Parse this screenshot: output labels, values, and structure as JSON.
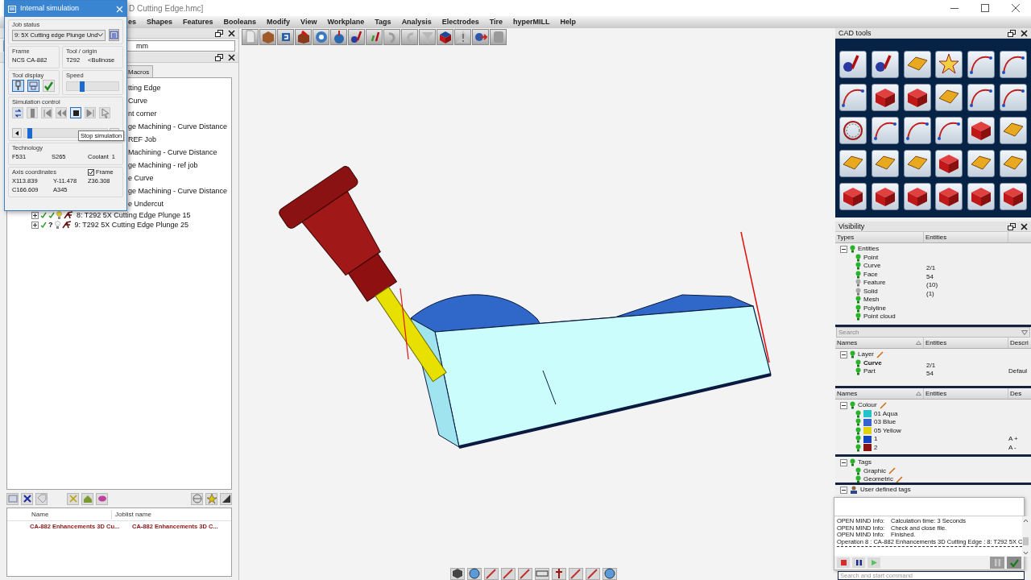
{
  "window": {
    "title": "D Cutting Edge.hmc]"
  },
  "menu": [
    "es",
    "Shapes",
    "Features",
    "Booleans",
    "Modify",
    "View",
    "Workplane",
    "Tags",
    "Analysis",
    "Electrodes",
    "Tire",
    "hyperMILL",
    "Help"
  ],
  "browser": {
    "field_value": "mm",
    "tabs": [
      {
        "label": "Macros",
        "selected": false
      }
    ],
    "tree": [
      {
        "text": "tting Edge"
      },
      {
        "text": "Curve"
      },
      {
        "text": "nt corner"
      },
      {
        "text": "ge Machining - Curve Distance"
      },
      {
        "text": "REF Job"
      },
      {
        "text": "Machining - Curve Distance"
      },
      {
        "text": "ge Machining - ref job"
      },
      {
        "text": "e Curve"
      },
      {
        "text": "ge Machining - Curve Distance"
      },
      {
        "text": "e Undercut"
      }
    ],
    "jobs": [
      {
        "text": "8: T292 5X Cutting Edge Plunge 15",
        "expanded": false,
        "visible": true
      },
      {
        "text": "9: T292 5X Cutting Edge Plunge 25",
        "expanded": false,
        "visible": false,
        "mark": "?"
      }
    ],
    "joblist": {
      "columns": [
        "Name",
        "Joblist name"
      ],
      "rows": [
        [
          "CA-882 Enhancements 3D Cu...",
          "CA-882 Enhancements 3D C..."
        ]
      ]
    }
  },
  "simulation": {
    "title": "Internal simulation",
    "job_status_label": "Job status",
    "job": "9: 5X Cutting edge Plunge Und",
    "frame_label": "Frame",
    "frame": "NCS CA-882",
    "tool_label": "Tool / origin",
    "tool": "T292",
    "origin": "<Bullnose",
    "tool_display_label": "Tool display",
    "tool_display": [
      {
        "kind": "tool",
        "selected": true
      },
      {
        "kind": "holder",
        "selected": true
      },
      {
        "kind": "check",
        "selected": false
      }
    ],
    "speed_label": "Speed",
    "speed": {
      "level": 0.3
    },
    "control_label": "Simulation control",
    "controls": [
      {
        "kind": "refresh",
        "selected": false
      },
      {
        "kind": "bar",
        "selected": false
      },
      {
        "kind": "first",
        "selected": false
      },
      {
        "kind": "rewind",
        "selected": false
      },
      {
        "kind": "stop",
        "selected": true
      },
      {
        "kind": "last",
        "selected": false
      },
      {
        "kind": "pointer",
        "selected": false
      }
    ],
    "tooltip": "Stop simulation",
    "progress": {
      "level": 0.04
    },
    "technology_label": "Technology",
    "feed": "F531",
    "spindle": "S265",
    "coolant_label": "Coolant",
    "coolant": "1",
    "axis_label": "Axis coordinates",
    "frame_checkbox": {
      "label": "Frame",
      "checked": true
    },
    "coordinates": [
      "X113.839",
      "Y-11.478",
      "Z36.308",
      "C166.609",
      "A345"
    ]
  },
  "cad_tools": {
    "title": "CAD tools"
  },
  "visibility": {
    "title": "Visibility",
    "types_columns": [
      "Types",
      "Entities"
    ],
    "types": [
      {
        "label": "Entities",
        "visible": true,
        "expanded": true,
        "children": [
          {
            "label": "Point",
            "visible": true
          },
          {
            "label": "Curve",
            "visible": true,
            "entities": "2/1"
          },
          {
            "label": "Face",
            "visible": true,
            "entities": "54"
          },
          {
            "label": "Feature",
            "visible": false,
            "entities": "(10)"
          },
          {
            "label": "Solid",
            "visible": false,
            "entities": "(1)"
          },
          {
            "label": "Mesh",
            "visible": true
          },
          {
            "label": "Polyline",
            "visible": true
          },
          {
            "label": "Point cloud",
            "visible": true
          }
        ]
      }
    ],
    "search": {
      "placeholder": "Search"
    },
    "layer_columns": [
      "Names",
      "Entities",
      "Descri"
    ],
    "layers": [
      {
        "label": "Layer",
        "visible": true,
        "expanded": true,
        "editable": true,
        "children": [
          {
            "label": "Curve",
            "visible": true,
            "active": true,
            "entities": "2/1"
          },
          {
            "label": "Part",
            "visible": true,
            "active": false,
            "entities": "54",
            "description": "Defaul"
          }
        ]
      }
    ],
    "colour_columns": [
      "Names",
      "Entities",
      "Des"
    ],
    "colours": [
      {
        "label": "Colour",
        "visible": true,
        "expanded": true,
        "editable": true,
        "children": [
          {
            "label": "01 Aqua",
            "visible": true,
            "color": "#22c4cc"
          },
          {
            "label": "03 Blue",
            "visible": true,
            "color": "#3563d4"
          },
          {
            "label": "05 Yellow",
            "visible": true,
            "color": "#e2d20a"
          },
          {
            "label": "1",
            "visible": true,
            "color": "#1244c2",
            "description": "A +"
          },
          {
            "label": "2",
            "visible": true,
            "color": "#8c1212",
            "description": "A -"
          }
        ]
      }
    ],
    "tags": [
      {
        "label": "Tags",
        "visible": true,
        "expanded": true,
        "children": [
          {
            "label": "Graphic",
            "visible": true,
            "editable": true
          },
          {
            "label": "Geometric",
            "visible": true,
            "editable": true
          }
        ]
      }
    ],
    "user_tags": {
      "label": "User defined tags",
      "expanded": true
    }
  },
  "log": {
    "lines": [
      {
        "source": "OPEN MIND Info:",
        "message": "Calculation time: 3 Seconds"
      },
      {
        "source": "OPEN MIND Info:",
        "message": "Check and close file."
      },
      {
        "source": "OPEN MIND Info:",
        "message": "Finished."
      }
    ],
    "operation": "Operation 8 : CA-882 Enhancements 3D Cutting Edge :  8: T292 5X C"
  },
  "command_search": {
    "placeholder": "Search and start command"
  }
}
